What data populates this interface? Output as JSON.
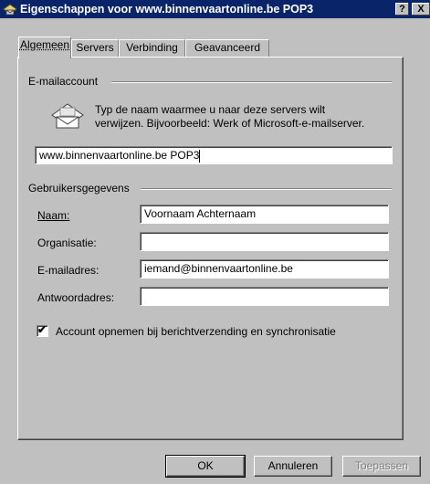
{
  "window": {
    "title": "Eigenschappen voor www.binnenvaartonline.be POP3",
    "help_label": "?",
    "close_label": "X"
  },
  "tabs": [
    {
      "label": "Algemeen",
      "active": true
    },
    {
      "label": "Servers",
      "active": false
    },
    {
      "label": "Verbinding",
      "active": false
    },
    {
      "label": "Geavanceerd",
      "active": false
    }
  ],
  "email_account": {
    "group_label": "E-mailaccount",
    "description_line1": "Typ de naam waarmee u naar deze servers wilt",
    "description_line2": "verwijzen. Bijvoorbeeld: Werk of Microsoft-e-mailserver.",
    "account_name": "www.binnenvaartonline.be POP3"
  },
  "user_info": {
    "group_label": "Gebruikersgegevens",
    "fields": [
      {
        "label": "Naam:",
        "value": "Voornaam Achternaam"
      },
      {
        "label": "Organisatie:",
        "value": ""
      },
      {
        "label": "E-mailadres:",
        "value": "iemand@binnenvaartonline.be"
      },
      {
        "label": "Antwoordadres:",
        "value": ""
      }
    ]
  },
  "sync_checkbox": {
    "label": "Account opnemen bij berichtverzending en synchronisatie",
    "checked": true,
    "check_glyph": "✔"
  },
  "buttons": {
    "ok": "OK",
    "cancel": "Annuleren",
    "apply": "Toepassen"
  },
  "colors": {
    "titlebar": "#0a246a",
    "face": "#c0c0c0"
  }
}
